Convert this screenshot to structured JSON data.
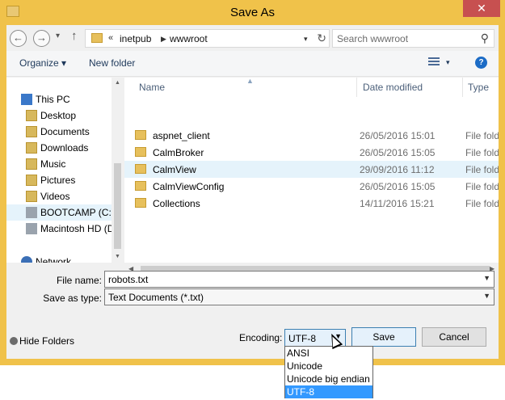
{
  "window": {
    "title": "Save As",
    "close_glyph": "✕",
    "accent_color": "#f0c24a"
  },
  "nav": {
    "back_glyph": "←",
    "forward_glyph": "→",
    "up_glyph": "↑",
    "address_overflow": "«",
    "address_parts": [
      "inetpub",
      "wwwroot"
    ],
    "address_sep": "▶",
    "refresh_glyph": "↻",
    "search_placeholder": "Search wwwroot",
    "search_glyph": "⚲"
  },
  "toolbar": {
    "organize_label": "Organize ▾",
    "new_folder_label": "New folder",
    "help_glyph": "?"
  },
  "navpane": {
    "items": [
      {
        "label": "This PC",
        "icon": "computer-icon"
      },
      {
        "label": "Desktop",
        "icon": "desktop-folder-icon"
      },
      {
        "label": "Documents",
        "icon": "documents-folder-icon"
      },
      {
        "label": "Downloads",
        "icon": "downloads-folder-icon"
      },
      {
        "label": "Music",
        "icon": "music-folder-icon"
      },
      {
        "label": "Pictures",
        "icon": "pictures-folder-icon"
      },
      {
        "label": "Videos",
        "icon": "videos-folder-icon"
      },
      {
        "label": "BOOTCAMP (C:)",
        "icon": "drive-icon"
      },
      {
        "label": "Macintosh HD (D",
        "icon": "drive-icon"
      },
      {
        "label": "Network",
        "icon": "network-icon"
      }
    ]
  },
  "files": {
    "columns": [
      "Name",
      "Date modified",
      "Type"
    ],
    "rows": [
      {
        "name": "aspnet_client",
        "date": "26/05/2016 15:01",
        "type": "File folder"
      },
      {
        "name": "CalmBroker",
        "date": "26/05/2016 15:05",
        "type": "File folder"
      },
      {
        "name": "CalmView",
        "date": "29/09/2016 11:12",
        "type": "File folder"
      },
      {
        "name": "CalmViewConfig",
        "date": "26/05/2016 15:05",
        "type": "File folder"
      },
      {
        "name": "Collections",
        "date": "14/11/2016 15:21",
        "type": "File folder"
      }
    ]
  },
  "form": {
    "file_name_label": "File name:",
    "file_name_value": "robots.txt",
    "save_type_label": "Save as type:",
    "save_type_value": "Text Documents (*.txt)",
    "hide_folders_label": "Hide Folders",
    "encoding_label": "Encoding:",
    "encoding_value": "UTF-8",
    "save_label": "Save",
    "cancel_label": "Cancel",
    "encoding_options": [
      "ANSI",
      "Unicode",
      "Unicode big endian",
      "UTF-8"
    ]
  }
}
